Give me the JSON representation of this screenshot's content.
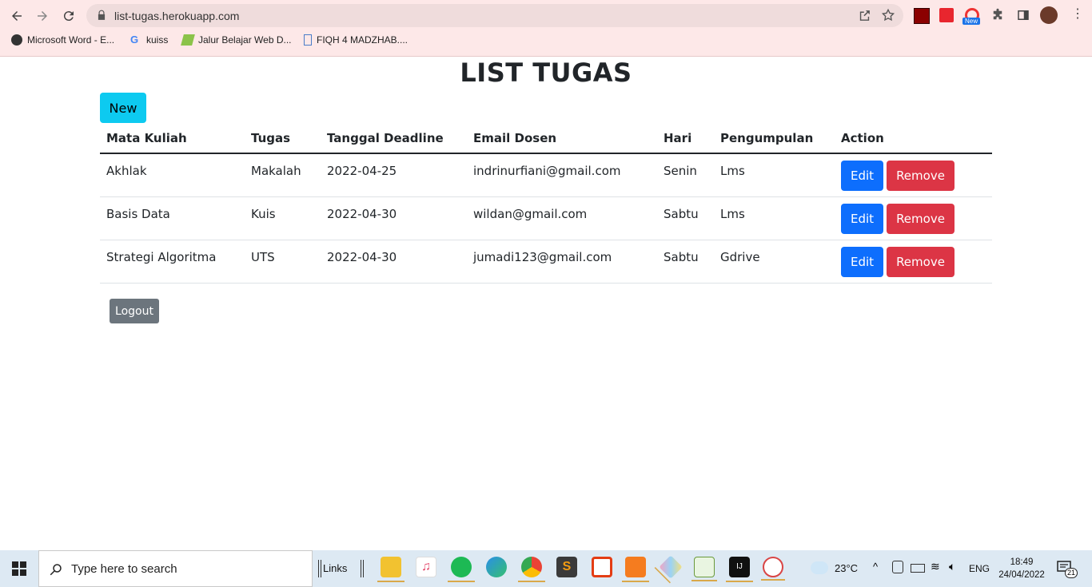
{
  "browser": {
    "url": "list-tugas.herokuapp.com",
    "bookmarks": [
      {
        "label": "Microsoft Word - E...",
        "icon": "github-icon"
      },
      {
        "label": "kuiss",
        "icon": "google-icon"
      },
      {
        "label": "Jalur Belajar Web D...",
        "icon": "dicoding-icon"
      },
      {
        "label": "FIQH 4 MADZHAB....",
        "icon": "document-icon"
      }
    ],
    "new_badge": "New"
  },
  "page": {
    "title": "LIST TUGAS",
    "new_button": "New",
    "logout_button": "Logout"
  },
  "table": {
    "headers": [
      "Mata Kuliah",
      "Tugas",
      "Tanggal Deadline",
      "Email Dosen",
      "Hari",
      "Pengumpulan",
      "Action"
    ],
    "rows": [
      {
        "mata_kuliah": "Akhlak",
        "tugas": "Makalah",
        "deadline": "2022-04-25",
        "email": "indrinurfiani@gmail.com",
        "hari": "Senin",
        "pengumpulan": "Lms"
      },
      {
        "mata_kuliah": "Basis Data",
        "tugas": "Kuis",
        "deadline": "2022-04-30",
        "email": "wildan@gmail.com",
        "hari": "Sabtu",
        "pengumpulan": "Lms"
      },
      {
        "mata_kuliah": "Strategi Algoritma",
        "tugas": "UTS",
        "deadline": "2022-04-30",
        "email": "jumadi123@gmail.com",
        "hari": "Sabtu",
        "pengumpulan": "Gdrive"
      }
    ],
    "edit_label": "Edit",
    "remove_label": "Remove"
  },
  "taskbar": {
    "search_placeholder": "Type here to search",
    "links_label": "Links",
    "temperature": "23°C",
    "language": "ENG",
    "time": "18:49",
    "date": "24/04/2022",
    "notification_count": "21"
  }
}
